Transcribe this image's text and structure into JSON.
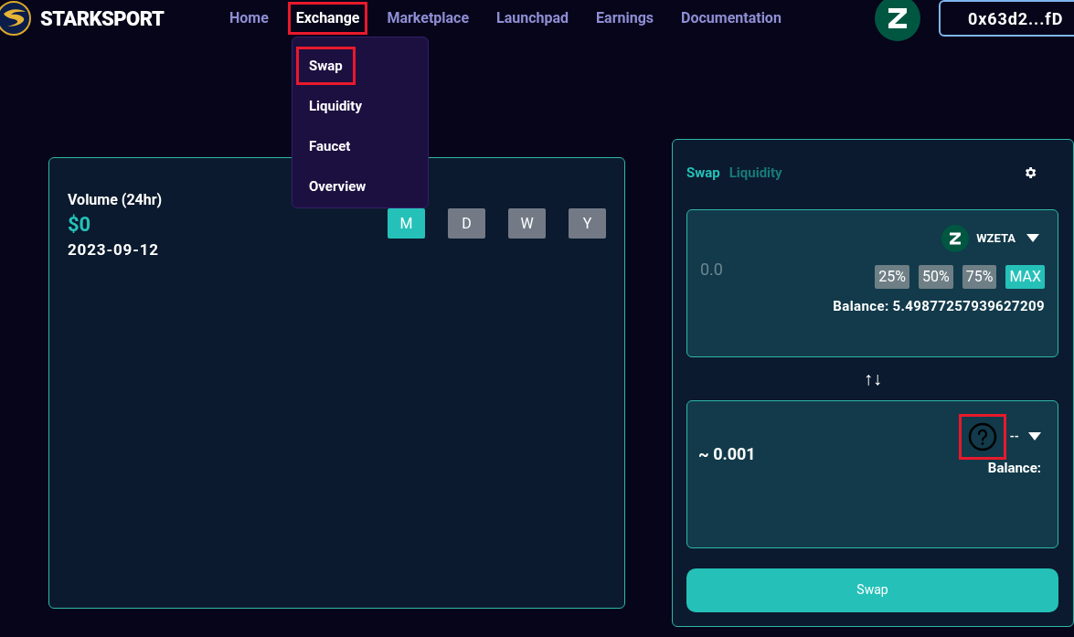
{
  "brand": {
    "name": "STARKSPORT"
  },
  "nav": [
    {
      "label": "Home",
      "selected": false,
      "highlighted": false
    },
    {
      "label": "Exchange",
      "selected": true,
      "highlighted": true
    },
    {
      "label": "Marketplace",
      "selected": false,
      "highlighted": false
    },
    {
      "label": "Launchpad",
      "selected": false,
      "highlighted": false
    },
    {
      "label": "Earnings",
      "selected": false,
      "highlighted": false
    },
    {
      "label": "Documentation",
      "selected": false,
      "highlighted": false
    }
  ],
  "wallet": {
    "address": "0x63d2...fD"
  },
  "dropdown": [
    {
      "label": "Swap",
      "highlighted": true
    },
    {
      "label": "Liquidity",
      "highlighted": false
    },
    {
      "label": "Faucet",
      "highlighted": false
    },
    {
      "label": "Overview",
      "highlighted": false
    }
  ],
  "volume": {
    "title": "Volume (24hr)",
    "value": "$0",
    "date": "2023-09-12",
    "ranges": [
      {
        "label": "M",
        "selected": true
      },
      {
        "label": "D",
        "selected": false
      },
      {
        "label": "W",
        "selected": false
      },
      {
        "label": "Y",
        "selected": false
      }
    ]
  },
  "swap_panel": {
    "tabs": [
      {
        "label": "Swap",
        "selected": true
      },
      {
        "label": "Liquidity",
        "selected": false
      }
    ],
    "from": {
      "placeholder": "0.0",
      "token": "WZETA",
      "percent_buttons": [
        {
          "label": "25%",
          "selected": false
        },
        {
          "label": "50%",
          "selected": false
        },
        {
          "label": "75%",
          "selected": false
        },
        {
          "label": "MAX",
          "selected": true
        }
      ],
      "balance": "Balance: 5.49877257939627209"
    },
    "switch_icon": "↑↓",
    "to": {
      "amount": "~ 0.001",
      "token": "--",
      "token_highlighted": true,
      "balance": "Balance:"
    },
    "button": "Swap"
  }
}
